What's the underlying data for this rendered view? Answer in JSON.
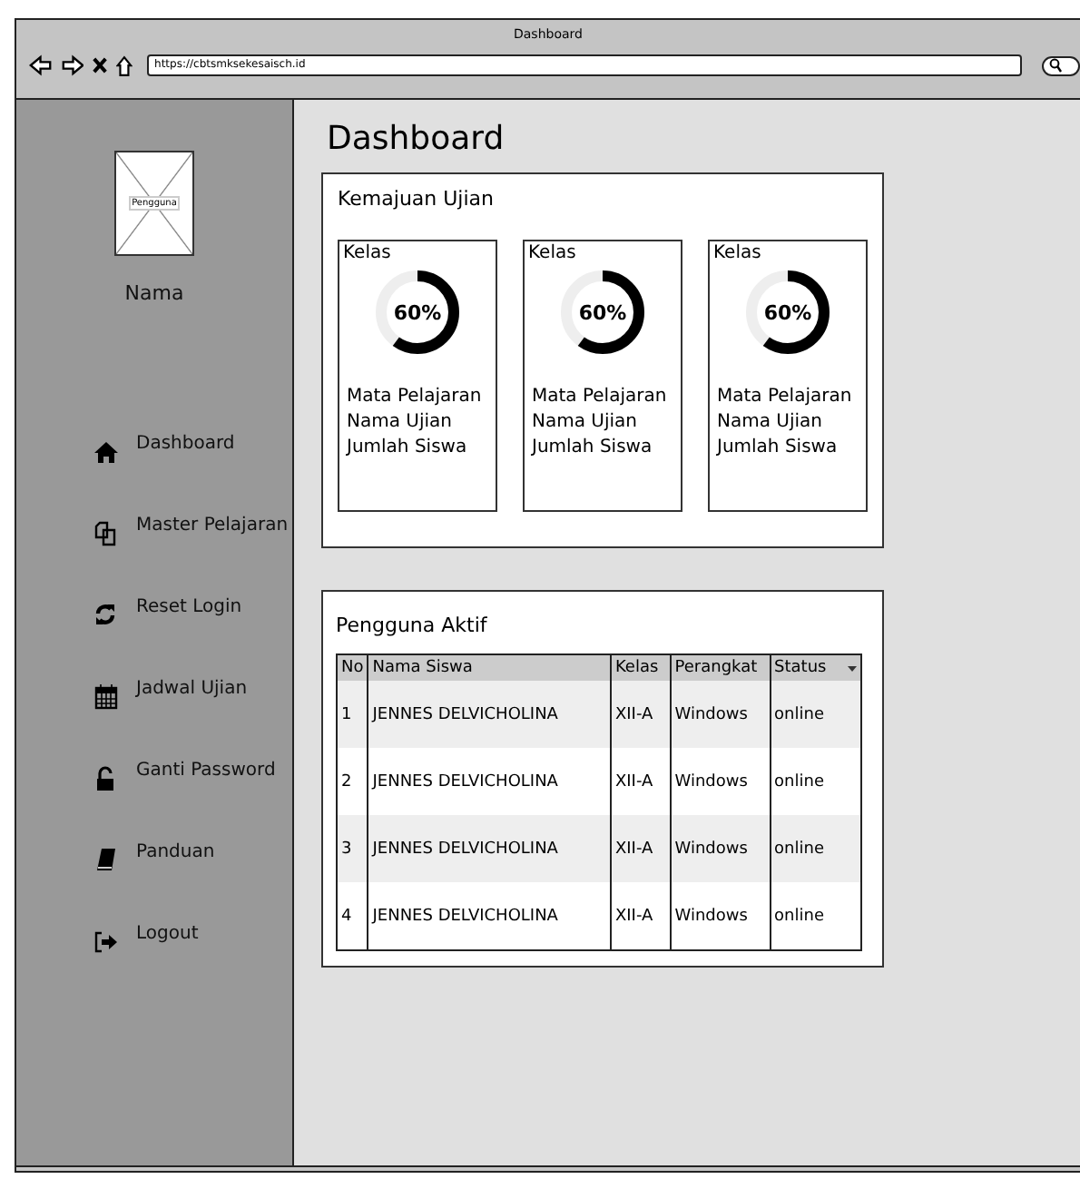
{
  "window": {
    "title": "Dashboard",
    "url": "https://cbtsmksekesaisch.id"
  },
  "sidebar": {
    "avatar_label": "Pengguna",
    "user_name": "Nama",
    "items": [
      {
        "label": "Dashboard"
      },
      {
        "label": "Master Pelajaran"
      },
      {
        "label": "Reset Login"
      },
      {
        "label": "Jadwal Ujian"
      },
      {
        "label": "Ganti Password"
      },
      {
        "label": "Panduan"
      },
      {
        "label": "Logout"
      }
    ]
  },
  "page_title": "Dashboard",
  "progress_panel": {
    "title": "Kemajuan Ujian",
    "cards": [
      {
        "class_label": "Kelas",
        "level": 0.6,
        "percent": "60%",
        "lines": [
          "Mata Pelajaran",
          "Nama Ujian",
          "Jumlah Siswa"
        ]
      },
      {
        "class_label": "Kelas",
        "level": 0.6,
        "percent": "60%",
        "lines": [
          "Mata Pelajaran",
          "Nama Ujian",
          "Jumlah Siswa"
        ]
      },
      {
        "class_label": "Kelas",
        "level": 0.6,
        "percent": "60%",
        "lines": [
          "Mata Pelajaran",
          "Nama Ujian",
          "Jumlah Siswa"
        ]
      }
    ]
  },
  "users_panel": {
    "title": "Pengguna Aktif",
    "table": {
      "columns": [
        "No",
        "Nama Siswa",
        "Kelas",
        "Perangkat",
        "Status"
      ],
      "rows": [
        [
          "1",
          "JENNES DELVICHOLINA",
          "XII-A",
          "Windows",
          "online"
        ],
        [
          "2",
          "JENNES DELVICHOLINA",
          "XII-A",
          "Windows",
          "online"
        ],
        [
          "3",
          "JENNES DELVICHOLINA",
          "XII-A",
          "Windows",
          "online"
        ],
        [
          "4",
          "JENNES DELVICHOLINA",
          "XII-A",
          "Windows",
          "online"
        ]
      ]
    }
  }
}
